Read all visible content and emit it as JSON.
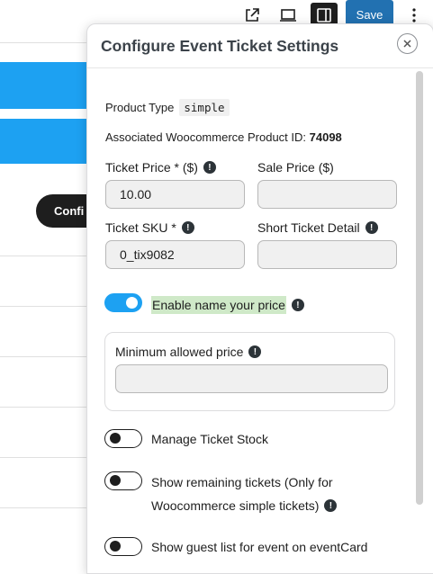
{
  "toolbar": {
    "save_label": "Save",
    "icons": [
      "external-link-icon",
      "desktop-preview-icon",
      "sidebar-panel-icon",
      "more-options-icon"
    ]
  },
  "background": {
    "button_text": "Confi"
  },
  "modal": {
    "title": "Configure Event Ticket Settings",
    "product_type_label": "Product Type",
    "product_type_value": "simple",
    "product_id_label": "Associated Woocommerce Product ID:",
    "product_id_value": "74098",
    "ticket_price": {
      "label": "Ticket Price * ($)",
      "value": "10.00"
    },
    "sale_price": {
      "label": "Sale Price ($)",
      "value": ""
    },
    "ticket_sku": {
      "label": "Ticket SKU *",
      "value": "0_tix9082"
    },
    "short_detail": {
      "label": "Short Ticket Detail",
      "value": ""
    },
    "name_your_price": {
      "label": "Enable name your price",
      "enabled": true
    },
    "min_price": {
      "label": "Minimum allowed price",
      "value": ""
    },
    "manage_stock": {
      "label": "Manage Ticket Stock",
      "enabled": false
    },
    "remaining": {
      "label_line1": "Show remaining tickets (Only for",
      "label_line2": "Woocommerce simple tickets)",
      "enabled": false
    },
    "guest_list": {
      "label": "Show guest list for event on eventCard",
      "enabled": false
    }
  },
  "colors": {
    "accent": "#1da1f2",
    "save": "#2271b1",
    "highlight": "#cfe9c8"
  }
}
